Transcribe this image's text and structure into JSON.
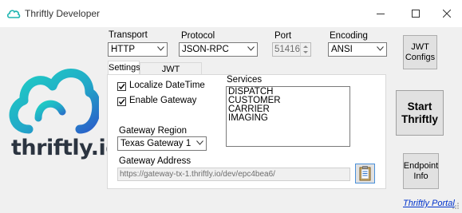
{
  "window": {
    "title": "Thriftly Developer"
  },
  "logo": {
    "text": "thriftly.io"
  },
  "transport": {
    "label": "Transport",
    "value": "HTTP"
  },
  "protocol": {
    "label": "Protocol",
    "value": "JSON-RPC"
  },
  "port": {
    "label": "Port",
    "value": "51416"
  },
  "encoding": {
    "label": "Encoding",
    "value": "ANSI"
  },
  "buttons": {
    "jwt_configs": [
      "JWT",
      "Configs"
    ],
    "start": [
      "Start",
      "Thriftly"
    ],
    "endpoint_info": [
      "Endpoint",
      "Info"
    ]
  },
  "tabs": [
    {
      "label": "Settings",
      "active": true
    },
    {
      "label": "JWT Configuration",
      "active": false
    }
  ],
  "settings": {
    "localize_datetime": {
      "label": "Localize DateTime",
      "checked": true
    },
    "enable_gateway": {
      "label": "Enable Gateway",
      "checked": true
    },
    "services_label": "Services",
    "services": [
      "DISPATCH",
      "CUSTOMER",
      "CARRIER",
      "IMAGING"
    ],
    "gateway_region": {
      "label": "Gateway Region",
      "value": "Texas Gateway 1"
    },
    "gateway_address": {
      "label": "Gateway Address",
      "value": "https://gateway-tx-1.thriftly.io/dev/epc4bea6/"
    }
  },
  "footer": {
    "portal_link": "Thriftly Portal"
  },
  "icons": {
    "app": "thriftly-cloud-icon",
    "minimize": "minimize-icon",
    "maximize": "maximize-icon",
    "close": "close-icon",
    "clipboard": "clipboard-icon"
  },
  "colors": {
    "logo_cloud_teal": "#1fb5b0",
    "logo_cloud_blue": "#2a6fc9",
    "logo_text": "#2b3440",
    "link": "#0033cc",
    "window_bg": "#f0f0f0"
  }
}
